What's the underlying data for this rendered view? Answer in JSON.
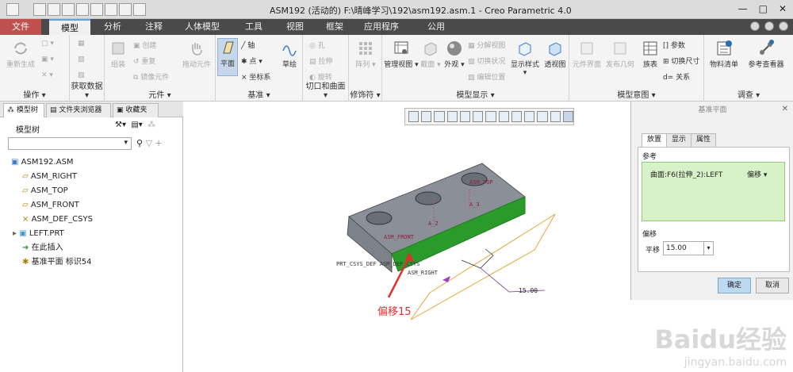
{
  "window": {
    "title": "ASM192 (活动的) F:\\晴峰学习\\192\\asm192.asm.1 - Creo Parametric 4.0"
  },
  "menu": {
    "tabs": [
      "文件",
      "模型",
      "分析",
      "注释",
      "人体模型",
      "工具",
      "视图",
      "框架",
      "应用程序",
      "公用"
    ],
    "active_tab": "模型"
  },
  "ribbon": {
    "groups": [
      {
        "label": "操作",
        "items": [
          "重新生成"
        ]
      },
      {
        "label": "获取数据",
        "items": []
      },
      {
        "label": "元件",
        "items": [
          "组装",
          "创建",
          "重复",
          "镜像元件",
          "拖动元件"
        ]
      },
      {
        "label": "基准",
        "items": [
          "平面",
          "轴",
          "点",
          "坐标系",
          "草绘"
        ]
      },
      {
        "label": "切口和曲面",
        "items": [
          "孔",
          "拉伸",
          "旋转"
        ]
      },
      {
        "label": "修饰符",
        "items": [
          "阵列"
        ]
      },
      {
        "label": "模型显示",
        "items": [
          "管理视图",
          "截面",
          "外观",
          "分解视图",
          "切换状况",
          "编辑位置",
          "显示样式",
          "透视图"
        ]
      },
      {
        "label": "模型意图",
        "items": [
          "元件界面",
          "发布几何",
          "族表",
          "参数",
          "切换尺寸",
          "关系"
        ]
      },
      {
        "label": "调查",
        "items": [
          "物料清单",
          "参考查看器"
        ]
      }
    ]
  },
  "left_panel": {
    "tabs": [
      "模型树",
      "文件夹浏览器",
      "收藏夹"
    ],
    "tree_title": "模型树",
    "tree": [
      {
        "label": "ASM192.ASM",
        "icon": "assembly-icon",
        "indent": 0
      },
      {
        "label": "ASM_RIGHT",
        "icon": "datum-plane-icon",
        "indent": 1
      },
      {
        "label": "ASM_TOP",
        "icon": "datum-plane-icon",
        "indent": 1
      },
      {
        "label": "ASM_FRONT",
        "icon": "datum-plane-icon",
        "indent": 1
      },
      {
        "label": "ASM_DEF_CSYS",
        "icon": "csys-icon",
        "indent": 1
      },
      {
        "label": "LEFT.PRT",
        "icon": "part-icon",
        "indent": 1
      },
      {
        "label": "在此插入",
        "icon": "insert-arrow-icon",
        "indent": 1
      },
      {
        "label": "基准平面 标识54",
        "icon": "datum-plane-new-icon",
        "indent": 1
      }
    ]
  },
  "canvas": {
    "labels": {
      "asm_top": "ASM_TOP",
      "a3": "A_3",
      "a2": "A_2",
      "asm_front": "ASM_FRONT",
      "csys": "PRT_CSYS_DEF ASM_DEF_CSYS",
      "asm_right": "ASM_RIGHT",
      "offset_value": "15.00",
      "annotation": "偏移15"
    }
  },
  "dialog": {
    "title": "基准平面",
    "tabs": [
      "放置",
      "显示",
      "属性"
    ],
    "ref_label": "参考",
    "ref_item": "曲面:F6(拉伸_2):LEFT",
    "ref_constraint": "偏移",
    "offset_label": "偏移",
    "translate_label": "平移",
    "translate_value": "15.00",
    "ok": "确定",
    "cancel": "取消"
  },
  "watermark": {
    "brand": "Baidu经验",
    "url": "jingyan.baidu.com"
  },
  "colors": {
    "menubar": "#4a4a4a",
    "highlight_edge": "#2a9a2a",
    "annotation": "#e03030",
    "accent": "#6aa0d4"
  }
}
